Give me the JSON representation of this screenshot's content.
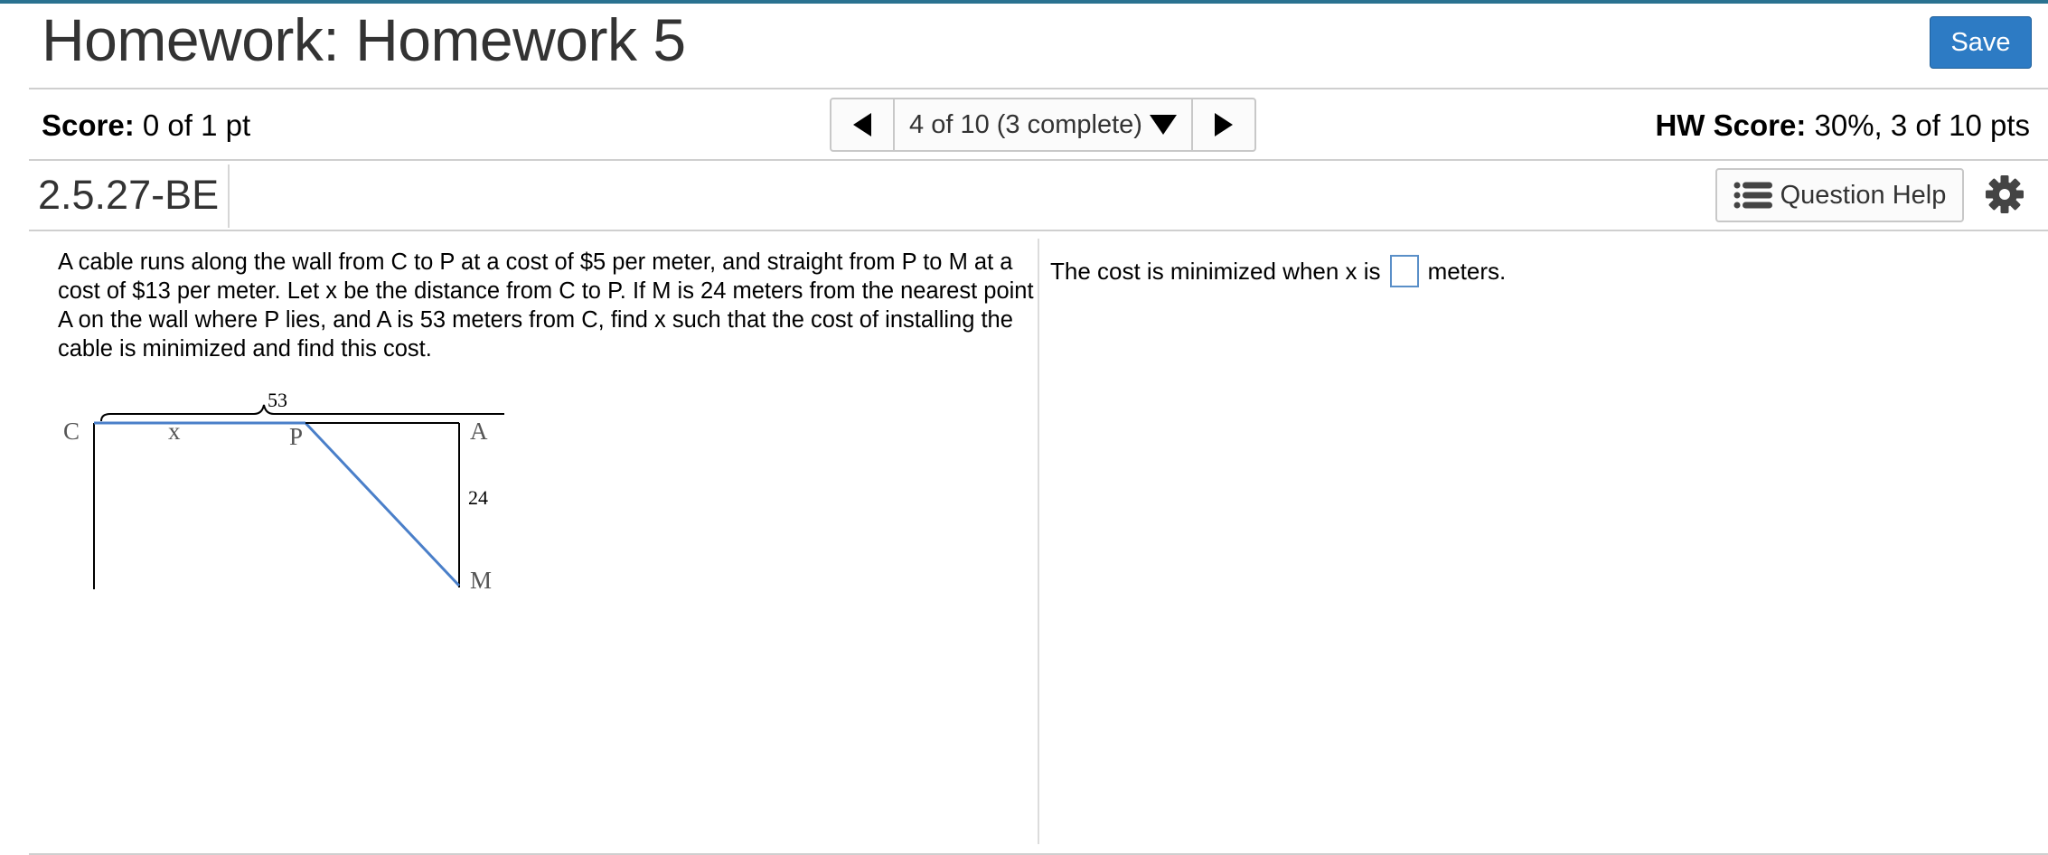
{
  "header": {
    "title": "Homework: Homework 5",
    "save_label": "Save"
  },
  "status": {
    "score_label": "Score:",
    "score_value": " 0 of 1 pt",
    "nav_label": "4 of 10 (3 complete)",
    "hw_score_label": "HW Score:",
    "hw_score_value": " 30%, 3 of 10 pts"
  },
  "question": {
    "id": "2.5.27-BE",
    "help_label": "Question Help",
    "text": "A cable runs along the wall from C to P at a cost of $5 per meter, and straight from P to M at a cost of $13 per meter. Let x be the distance from C to P. If M is 24 meters from the nearest point A on the wall where P lies, and A is 53 meters from C, find x such that the cost of installing the cable is minimized and find this cost.",
    "figure": {
      "label_53": "53",
      "label_c": "C",
      "label_x": "x",
      "label_p": "P",
      "label_a": "A",
      "label_24": "24",
      "label_m": "M",
      "cable_color": "#4a7fc9"
    }
  },
  "answer": {
    "prefix": "The cost is minimized when x is",
    "value": "",
    "suffix": "meters."
  },
  "colors": {
    "accent": "#2d7bc4",
    "top_bar": "#2a7290"
  }
}
